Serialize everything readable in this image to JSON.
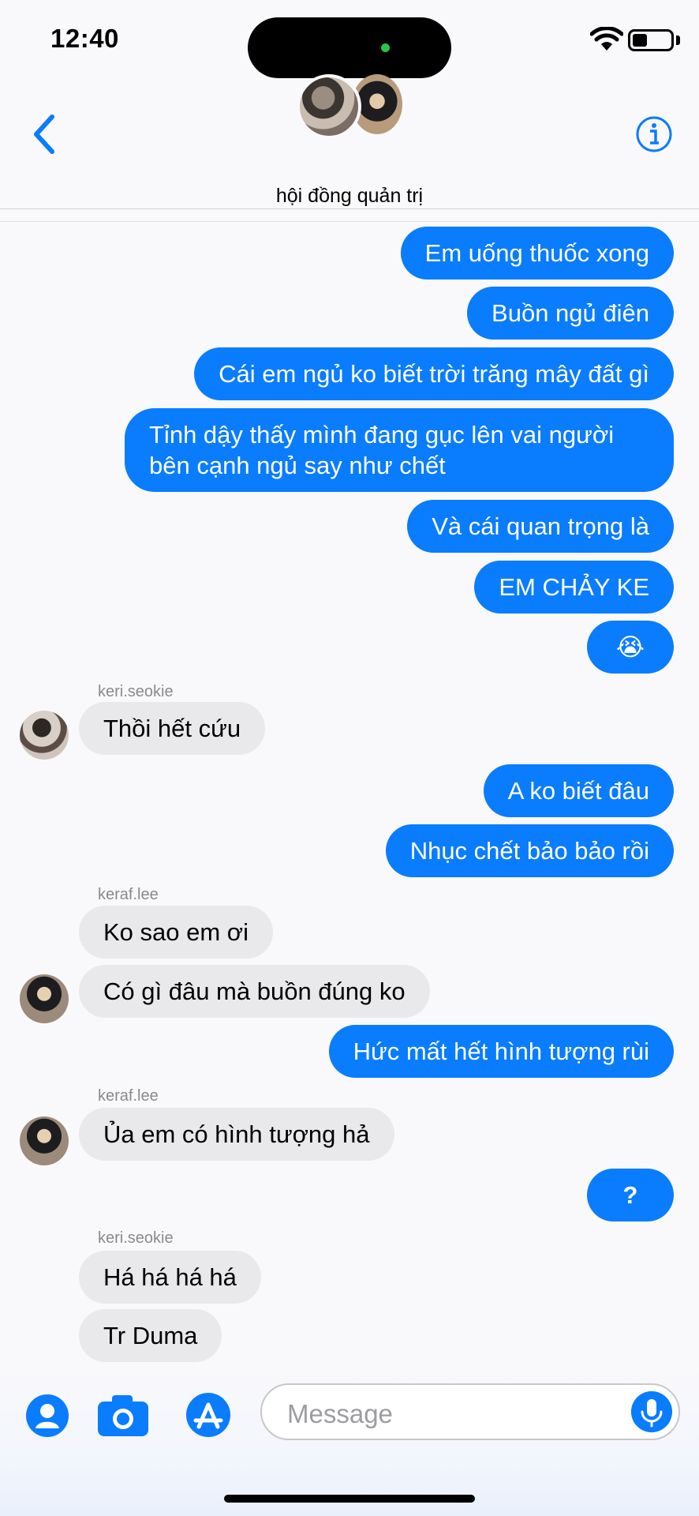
{
  "status": {
    "time": "12:40"
  },
  "header": {
    "group_name": "hội đồng quản trị"
  },
  "messages": [
    {
      "text": "Em uống thuốc xong"
    },
    {
      "text": "Buồn ngủ điên"
    },
    {
      "text": "Cái em ngủ ko biết trời trăng mây đất gì"
    },
    {
      "text": "Tỉnh dậy thấy mình đang gục lên vai người bên cạnh ngủ say như chết"
    },
    {
      "text": "Và cái quan trọng là"
    },
    {
      "text": "EM CHẢY KE"
    },
    {
      "text": "😭"
    },
    {
      "text": "Thồi hết cứu",
      "sender": "keri.seokie"
    },
    {
      "text": "A ko biết đâu"
    },
    {
      "text": "Nhục chết bảo bảo rồi"
    },
    {
      "text": "Ko sao em ơi",
      "sender": "keraf.lee"
    },
    {
      "text": "Có gì đâu mà buồn đúng ko"
    },
    {
      "text": "Hức mất hết hình tượng rùi"
    },
    {
      "text": "Ủa em có hình tượng hả",
      "sender": "keraf.lee"
    },
    {
      "text": "?"
    },
    {
      "text": "Há há há há",
      "sender": "keri.seokie"
    },
    {
      "text": "Tr Duma"
    }
  ],
  "composer": {
    "placeholder": "Message"
  },
  "icons": {
    "back": "chevron-left-icon",
    "info": "info-icon",
    "contact": "person-icon",
    "camera": "camera-icon",
    "appstore": "app-store-icon",
    "mic": "microphone-icon"
  },
  "colors": {
    "accent": "#0a7cfe",
    "incoming": "#e9e9eb",
    "background": "#f9f9fb"
  }
}
